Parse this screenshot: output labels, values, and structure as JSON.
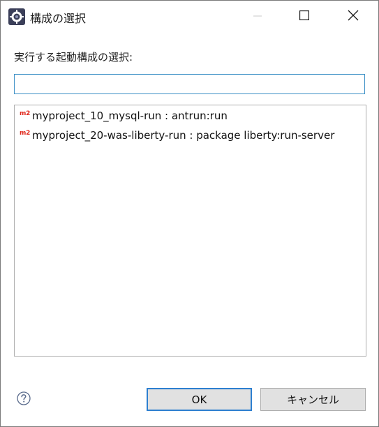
{
  "window": {
    "title": "構成の選択",
    "icon": "eclipse-gear-icon"
  },
  "titlebar_controls": {
    "minimize_icon": "minimize-icon",
    "maximize_icon": "maximize-icon",
    "close_icon": "close-icon"
  },
  "prompt": "実行する起動構成の選択:",
  "filter": {
    "value": "",
    "placeholder": ""
  },
  "configurations": [
    {
      "badge": "m2",
      "label": "myproject_10_mysql-run : antrun:run"
    },
    {
      "badge": "m2",
      "label": "myproject_20-was-liberty-run : package liberty:run-server"
    }
  ],
  "buttons": {
    "ok": "OK",
    "cancel": "キャンセル"
  },
  "help_icon": "help-icon",
  "colors": {
    "focus_border": "#3c90c6",
    "default_button_border": "#2d7fd0",
    "m2_badge": "#e0271b"
  }
}
